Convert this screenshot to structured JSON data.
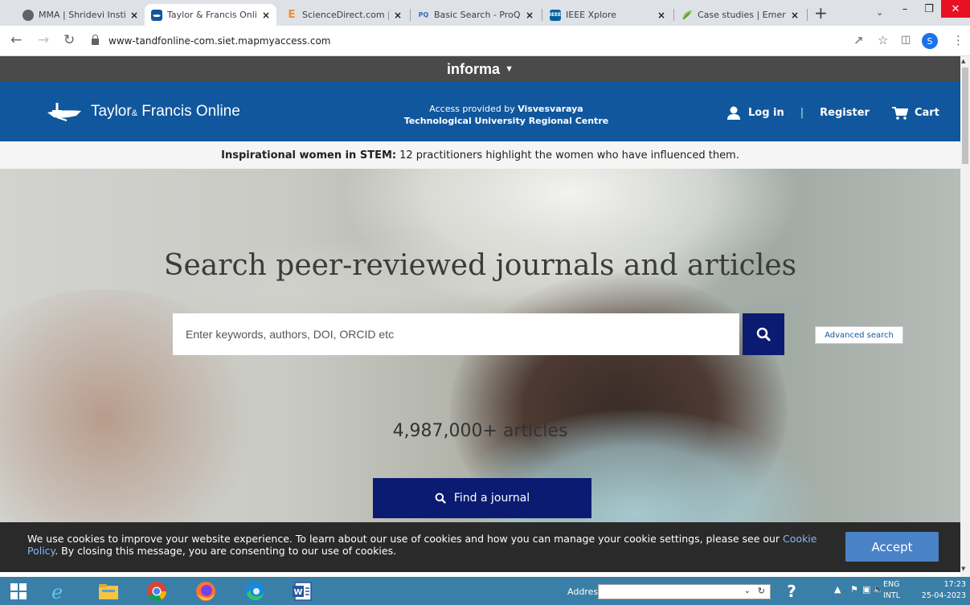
{
  "browser": {
    "tabs": [
      {
        "title": "MMA | Shridevi Instit",
        "active": false,
        "favicon_color": "#5f6368"
      },
      {
        "title": "Taylor & Francis Onli",
        "active": true,
        "favicon_color": "#10579d"
      },
      {
        "title": "ScienceDirect.com | S",
        "active": false,
        "favicon_color": "#f28c28"
      },
      {
        "title": "Basic Search - ProQu",
        "active": false,
        "favicon_color": "#2a6ebb"
      },
      {
        "title": "IEEE Xplore",
        "active": false,
        "favicon_color": "#00629b"
      },
      {
        "title": "Case studies | Emera",
        "active": false,
        "favicon_color": "#8bc34a"
      }
    ],
    "new_tab_label": "+",
    "tab_close_glyph": "×",
    "url": "www-tandfonline-com.siet.mapmyaccess.com",
    "profile_initial": "S"
  },
  "informa": {
    "label": "informa"
  },
  "header": {
    "brand_main": "Taylor",
    "brand_amp": "&",
    "brand_rest": " Francis Online",
    "access_prefix": "Access provided by ",
    "access_inst_line1": "Visvesvaraya",
    "access_inst_line2": "Technological University Regional Centre",
    "login_label": "Log in",
    "link_separator": "|",
    "register_label": "Register",
    "cart_label": "Cart"
  },
  "announcement": {
    "bold": "Inspirational women in STEM:",
    "text": "12 practitioners highlight the women who have influenced them."
  },
  "hero": {
    "title": "Search peer-reviewed journals and articles",
    "search_placeholder": "Enter keywords, authors, DOI, ORCID etc",
    "advanced_label": "Advanced search",
    "count": "4,987,000+ articles",
    "find_journal_label": "Find a journal"
  },
  "cookie": {
    "text_before": "We use cookies to improve your website experience. To learn about our use of cookies and how you can manage your cookie settings, please see our ",
    "link_text": "Cookie Policy",
    "text_after": ". By closing this message, you are consenting to our use of cookies.",
    "accept_label": "Accept"
  },
  "taskbar": {
    "address_label": "Address",
    "lang_line1": "ENG",
    "lang_line2": "INTL",
    "time": "17:23",
    "date": "25-04-2023"
  },
  "colors": {
    "tf_blue": "#10579d",
    "navy_button": "#0b1b72",
    "informa_bar": "#4a4a4a",
    "taskbar": "#3a7fa7",
    "accept_button": "#4a82c8"
  }
}
